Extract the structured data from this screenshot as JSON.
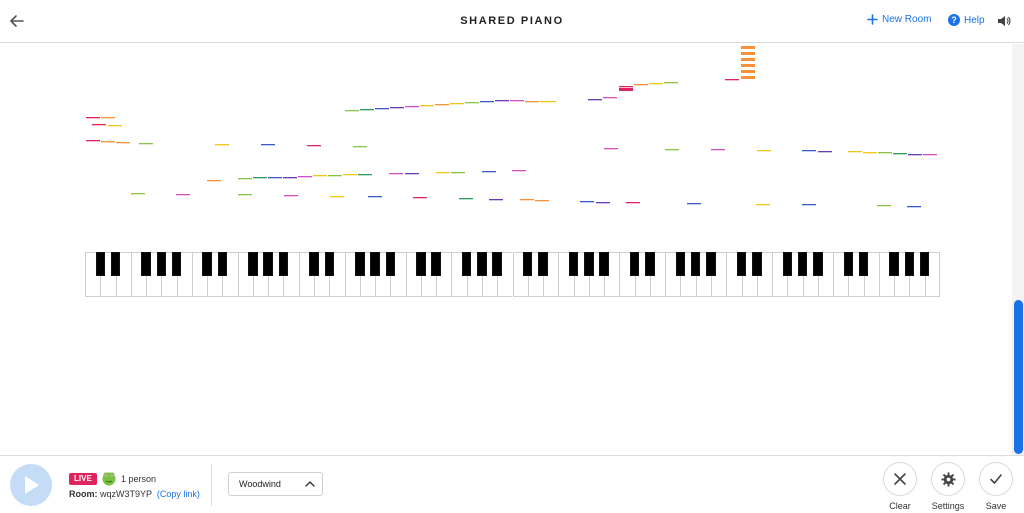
{
  "header": {
    "title": "SHARED PIANO",
    "new_room_label": "New Room",
    "help_label": "Help"
  },
  "icons": {
    "back": "arrow-left-icon",
    "new_room": "plus-icon",
    "help": "question-icon",
    "sound": "speaker-icon",
    "play": "play-icon",
    "clear": "close-icon",
    "settings": "gear-icon",
    "save": "check-icon",
    "frog": "frog-avatar-icon",
    "chevron": "chevron-up-icon"
  },
  "colors": {
    "accent": "#1a73e8",
    "live": "#e0245e",
    "note_colors": [
      "#e0245e",
      "#f7913a",
      "#f5c518",
      "#8bc34a",
      "#2e9b5e",
      "#3b5bcc",
      "#6a3bb6",
      "#d54fc7"
    ]
  },
  "keyboard": {
    "white_keys": 56
  },
  "footer": {
    "live_label": "LIVE",
    "people": "1 person",
    "room_label": "Room:",
    "room_code": "wqzW3T9YP",
    "copy_link": "(Copy link)",
    "instrument": "Woodwind",
    "clear_label": "Clear",
    "settings_label": "Settings",
    "save_label": "Save"
  }
}
